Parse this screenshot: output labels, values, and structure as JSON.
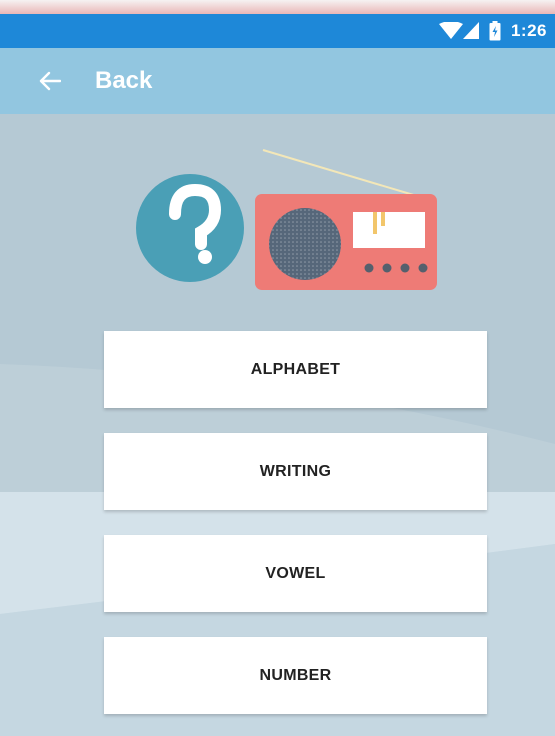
{
  "status_bar": {
    "time": "1:26",
    "icons": [
      "wifi-icon",
      "signal-icon",
      "battery-icon"
    ],
    "color": "#1e88d8"
  },
  "app_bar": {
    "back_icon": "arrow-left-icon",
    "title": "Back",
    "color": "#92c6e0"
  },
  "illustration": {
    "icons": [
      "question-mark-icon",
      "radio-icon"
    ],
    "colors": {
      "question": "#4a9fb6",
      "radio": "#ee7b76"
    }
  },
  "menu": {
    "items": [
      {
        "label": "ALPHABET"
      },
      {
        "label": "WRITING"
      },
      {
        "label": "VOWEL"
      },
      {
        "label": "NUMBER"
      }
    ]
  }
}
